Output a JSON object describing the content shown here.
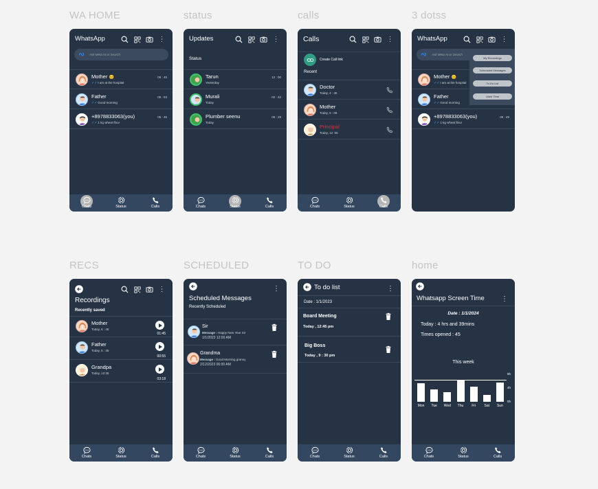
{
  "frames": {
    "wa_home": "WA HOME",
    "status": "status",
    "calls": "calls",
    "dots": "3 dotss",
    "recs": "RECS",
    "scheduled": "SCHEDULED",
    "todo": "TO DO",
    "home": "home"
  },
  "nav": {
    "chats": "Chats",
    "status": "Status",
    "calls": "Calls"
  },
  "wa_home": {
    "title": "WhatsApp",
    "search_placeholder": "Ask Meta AI or Search",
    "chats": [
      {
        "name": "Mother",
        "msg": "I am at the hospital",
        "time": "06 : 45",
        "emoji": "😊"
      },
      {
        "name": "Father",
        "msg": "Good morning",
        "time": "05 : 53",
        "emoji": ""
      },
      {
        "name": "+8978833063(you)",
        "msg": "1 kg wheat flour",
        "time": "05 : 45",
        "emoji": ""
      }
    ]
  },
  "status": {
    "title": "Updates",
    "section": "Status",
    "items": [
      {
        "name": "Tarun",
        "sub": "Yesterday",
        "time": "12 : 00"
      },
      {
        "name": "Murali",
        "sub": "Today",
        "time": "02 : 42"
      },
      {
        "name": "Plumber seenu",
        "sub": "Today",
        "time": "05 : 29"
      }
    ]
  },
  "calls": {
    "title": "Calls",
    "create_link": "Create Call link",
    "recent": "Recent",
    "items": [
      {
        "name": "Doctor",
        "sub": "Today, 4 : 45"
      },
      {
        "name": "Mother",
        "sub": "Today, 5 : 09"
      },
      {
        "name": "Principal",
        "sub": "Today, 12 :05"
      }
    ]
  },
  "dots": {
    "title": "WhatsApp",
    "search_placeholder": "Ask Meta AI or Search",
    "menu": [
      "My Recordings",
      "Scheduled Messages",
      "To Do List",
      "Used Time"
    ],
    "chats": [
      {
        "name": "Mother",
        "msg": "I am at the hospital",
        "emoji": "😊"
      },
      {
        "name": "Father",
        "msg": "Good morning"
      },
      {
        "name": "+8978833063(you)",
        "msg": "1 kg wheat flour",
        "time": "05 : 45"
      }
    ]
  },
  "recs": {
    "title": "Recordings",
    "section": "Recently saved",
    "items": [
      {
        "name": "Mother",
        "sub": "Today, 6 : 45",
        "dur": "01:45"
      },
      {
        "name": "Father",
        "sub": "Today, 5 : 35",
        "dur": "00:55"
      },
      {
        "name": "Grandpa",
        "sub": "Today, 12:35",
        "dur": "03:18"
      }
    ]
  },
  "scheduled": {
    "title": "Scheduled Messages",
    "section": "Recently Scheduled",
    "items": [
      {
        "name": "Sir",
        "label": "Message :",
        "msg": "Happy New Year Sir",
        "when": "1/1/2023    12:00 AM"
      },
      {
        "name": "Grandma",
        "label": "Message :",
        "msg": "Good Morning granny",
        "when": "2/12/2023    06:00 AM"
      }
    ]
  },
  "todo": {
    "title": "To do list",
    "date": "Date : 1/1/2023",
    "items": [
      {
        "title": "Board Meeting",
        "when": "Today , 12:45 pm"
      },
      {
        "title": "Big Boss",
        "when": "Today , 9 : 30 pm"
      }
    ]
  },
  "home": {
    "title": "Whatsapp Screen Time",
    "date": "Date : 1/1/2024",
    "today": "Today : 4 hrs and 39mins",
    "opened": "Times opened : 45",
    "week": "This week"
  },
  "chart_data": {
    "type": "bar",
    "title": "This week",
    "categories": [
      "Mon",
      "Tue",
      "Wed",
      "Thu",
      "Fri",
      "Sat",
      "Sun"
    ],
    "values": [
      5.4,
      3.6,
      2.8,
      6.3,
      4.5,
      2.0,
      5.6
    ],
    "yticks": [
      "8h",
      "4h",
      "0h"
    ],
    "ylim": [
      0,
      8
    ],
    "ref_line": 6.5
  }
}
